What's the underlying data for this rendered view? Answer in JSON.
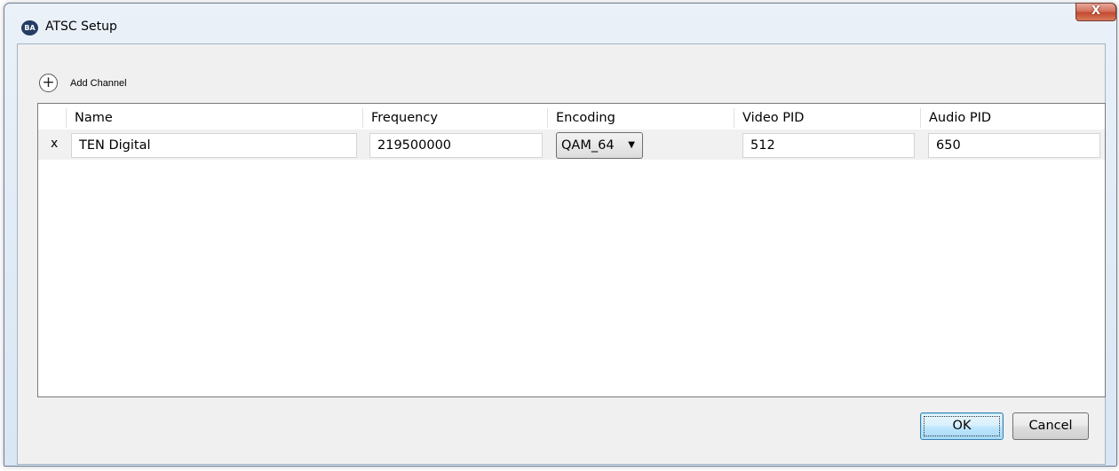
{
  "window": {
    "title": "ATSC Setup",
    "icon_text": "BA",
    "close_label": "X"
  },
  "toolbar": {
    "add_channel_label": "Add Channel"
  },
  "grid": {
    "columns": [
      "Name",
      "Frequency",
      "Encoding",
      "Video PID",
      "Audio PID"
    ],
    "rows": [
      {
        "delete_label": "x",
        "name": "TEN Digital",
        "frequency": "219500000",
        "encoding": "QAM_64",
        "video_pid": "512",
        "audio_pid": "650"
      }
    ]
  },
  "buttons": {
    "ok_label": "OK",
    "cancel_label": "Cancel"
  }
}
